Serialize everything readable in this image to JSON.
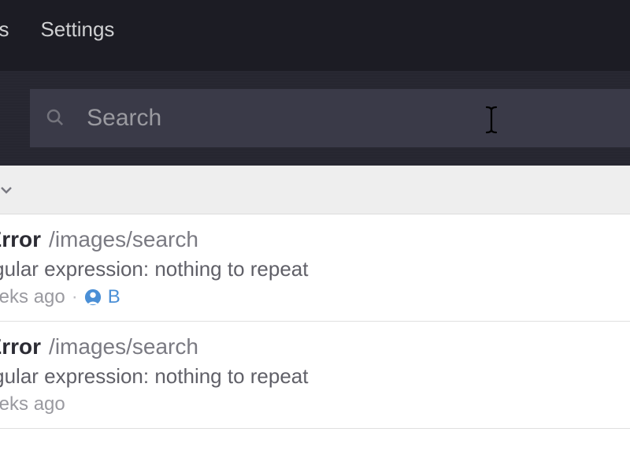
{
  "nav": {
    "item1": "es",
    "item2": "Settings"
  },
  "search": {
    "placeholder": "Search",
    "value": ""
  },
  "errors": [
    {
      "type": "xError",
      "path": "/images/search",
      "message": "regular expression: nothing to repeat",
      "time": "weeks ago",
      "user_initial": "B"
    },
    {
      "type": "xError",
      "path": "/images/search",
      "message": "regular expression: nothing to repeat",
      "time": "weeks ago",
      "user_initial": ""
    }
  ]
}
